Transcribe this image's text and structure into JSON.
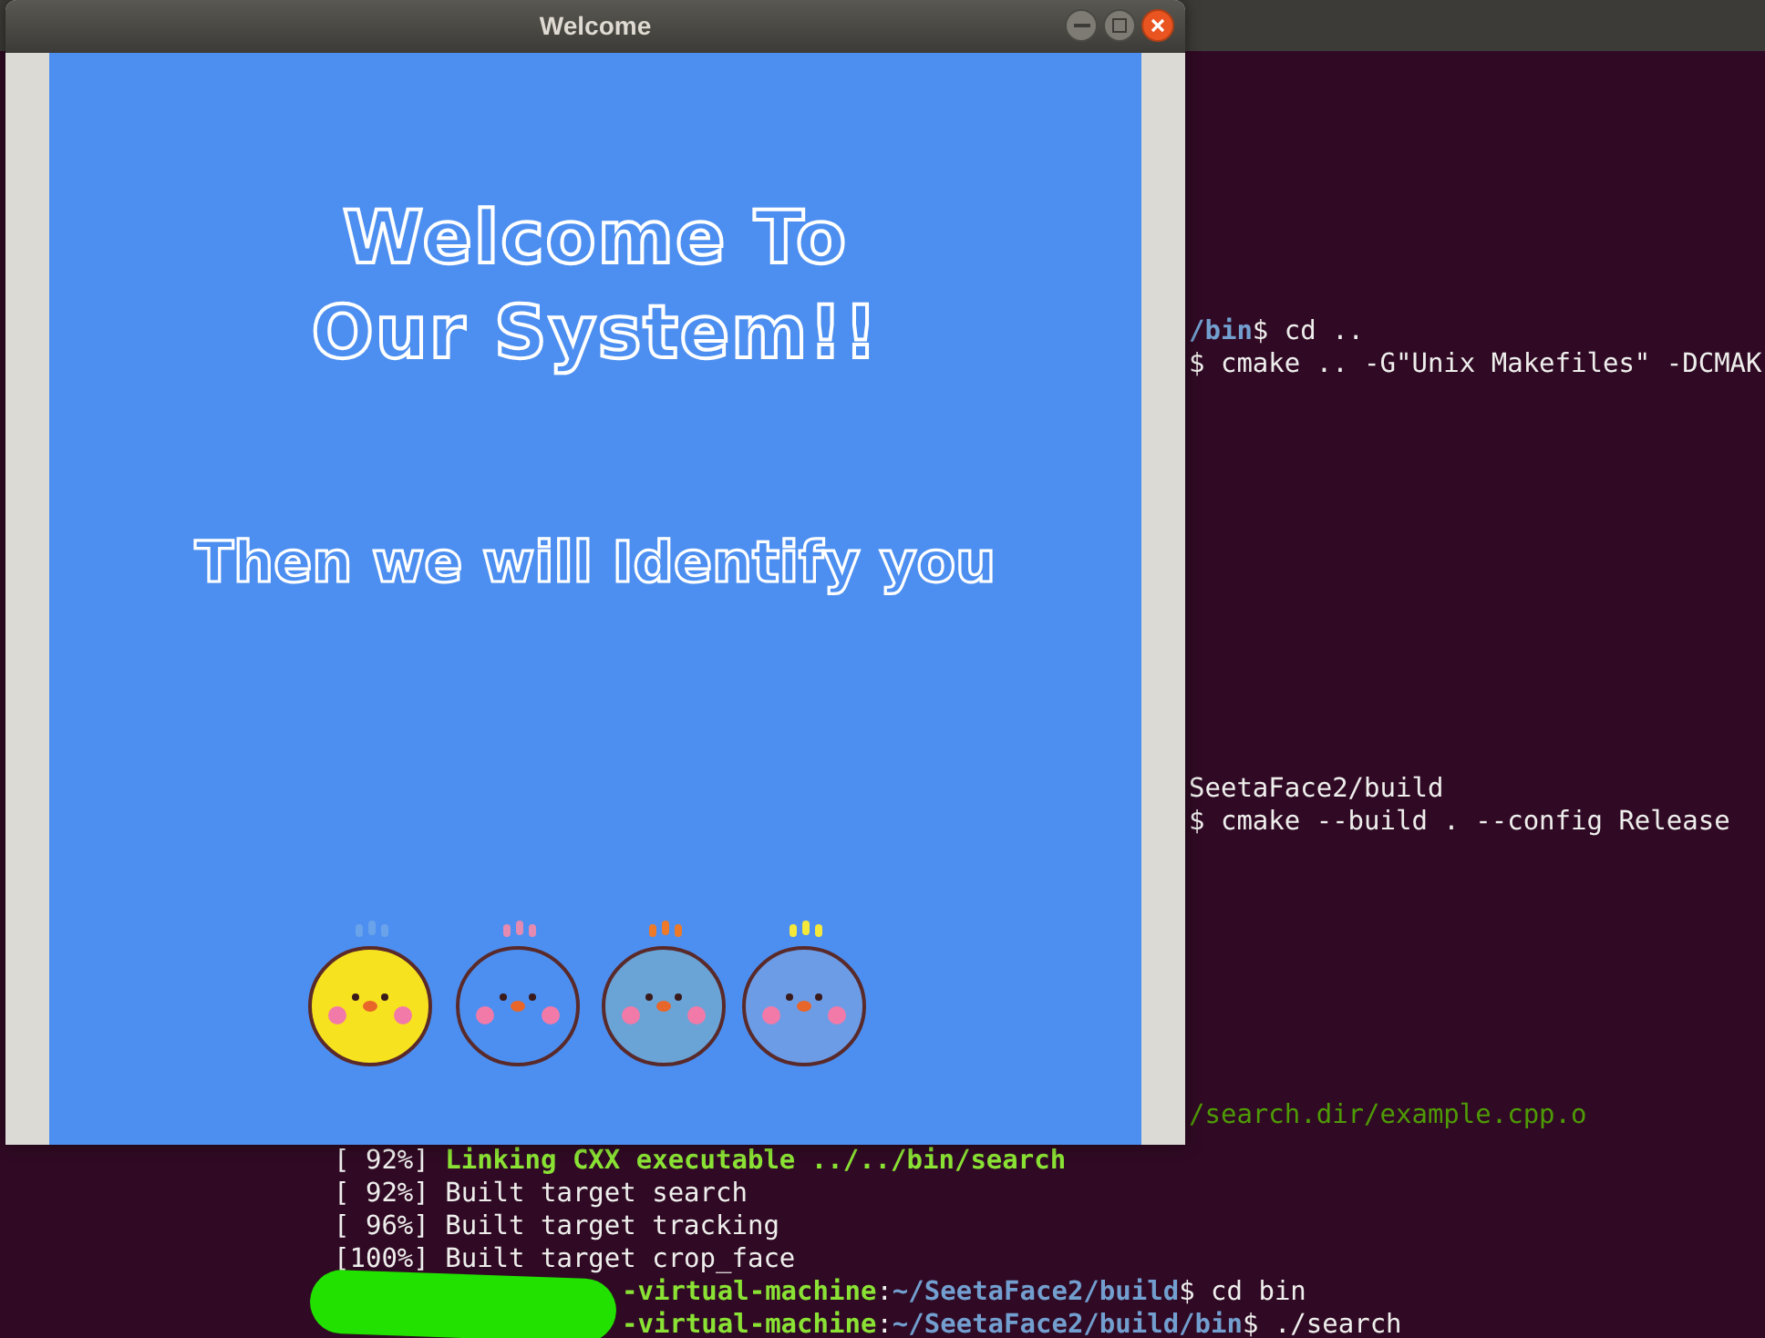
{
  "welcome_window": {
    "title": "Welcome",
    "headline": [
      "Welcome To",
      "Our System!!"
    ],
    "subtitle": "Then we will Identify you"
  },
  "terminal": {
    "blocks": [
      [
        [
          {
            "text": "/bin",
            "kind": "path"
          },
          {
            "text": "$ cd ..",
            "kind": "plain"
          }
        ],
        [
          {
            "text": "$ cmake .. -G\"Unix Makefiles\" -DCMAK",
            "kind": "plain"
          }
        ]
      ],
      [
        [
          {
            "text": "SeetaFace2/build",
            "kind": "plain"
          }
        ],
        [
          {
            "text": "$ cmake --build . --config Release",
            "kind": "plain"
          }
        ]
      ],
      [
        [
          {
            "text": "/search.dir/example.cpp.o",
            "kind": "build"
          }
        ]
      ],
      [
        [
          {
            "text": "[ 92%] ",
            "kind": "plain"
          },
          {
            "text": "Linking CXX executable ../../bin/search",
            "kind": "link"
          }
        ],
        [
          {
            "text": "[ 92%] Built target search",
            "kind": "plain"
          }
        ],
        [
          {
            "text": "[ 96%] Built target tracking",
            "kind": "plain"
          }
        ],
        [
          {
            "text": "[100%] Built target crop_face",
            "kind": "plain"
          }
        ],
        [
          {
            "text": "-virtual-machine",
            "kind": "user"
          },
          {
            "text": ":",
            "kind": "plain"
          },
          {
            "text": "~/SeetaFace2/build",
            "kind": "path"
          },
          {
            "text": "$ cd bin",
            "kind": "plain"
          }
        ],
        [
          {
            "text": "-virtual-machine",
            "kind": "user"
          },
          {
            "text": ":",
            "kind": "plain"
          },
          {
            "text": "~/SeetaFace2/build/bin",
            "kind": "path"
          },
          {
            "text": "$ ./search",
            "kind": "plain"
          }
        ]
      ]
    ]
  }
}
